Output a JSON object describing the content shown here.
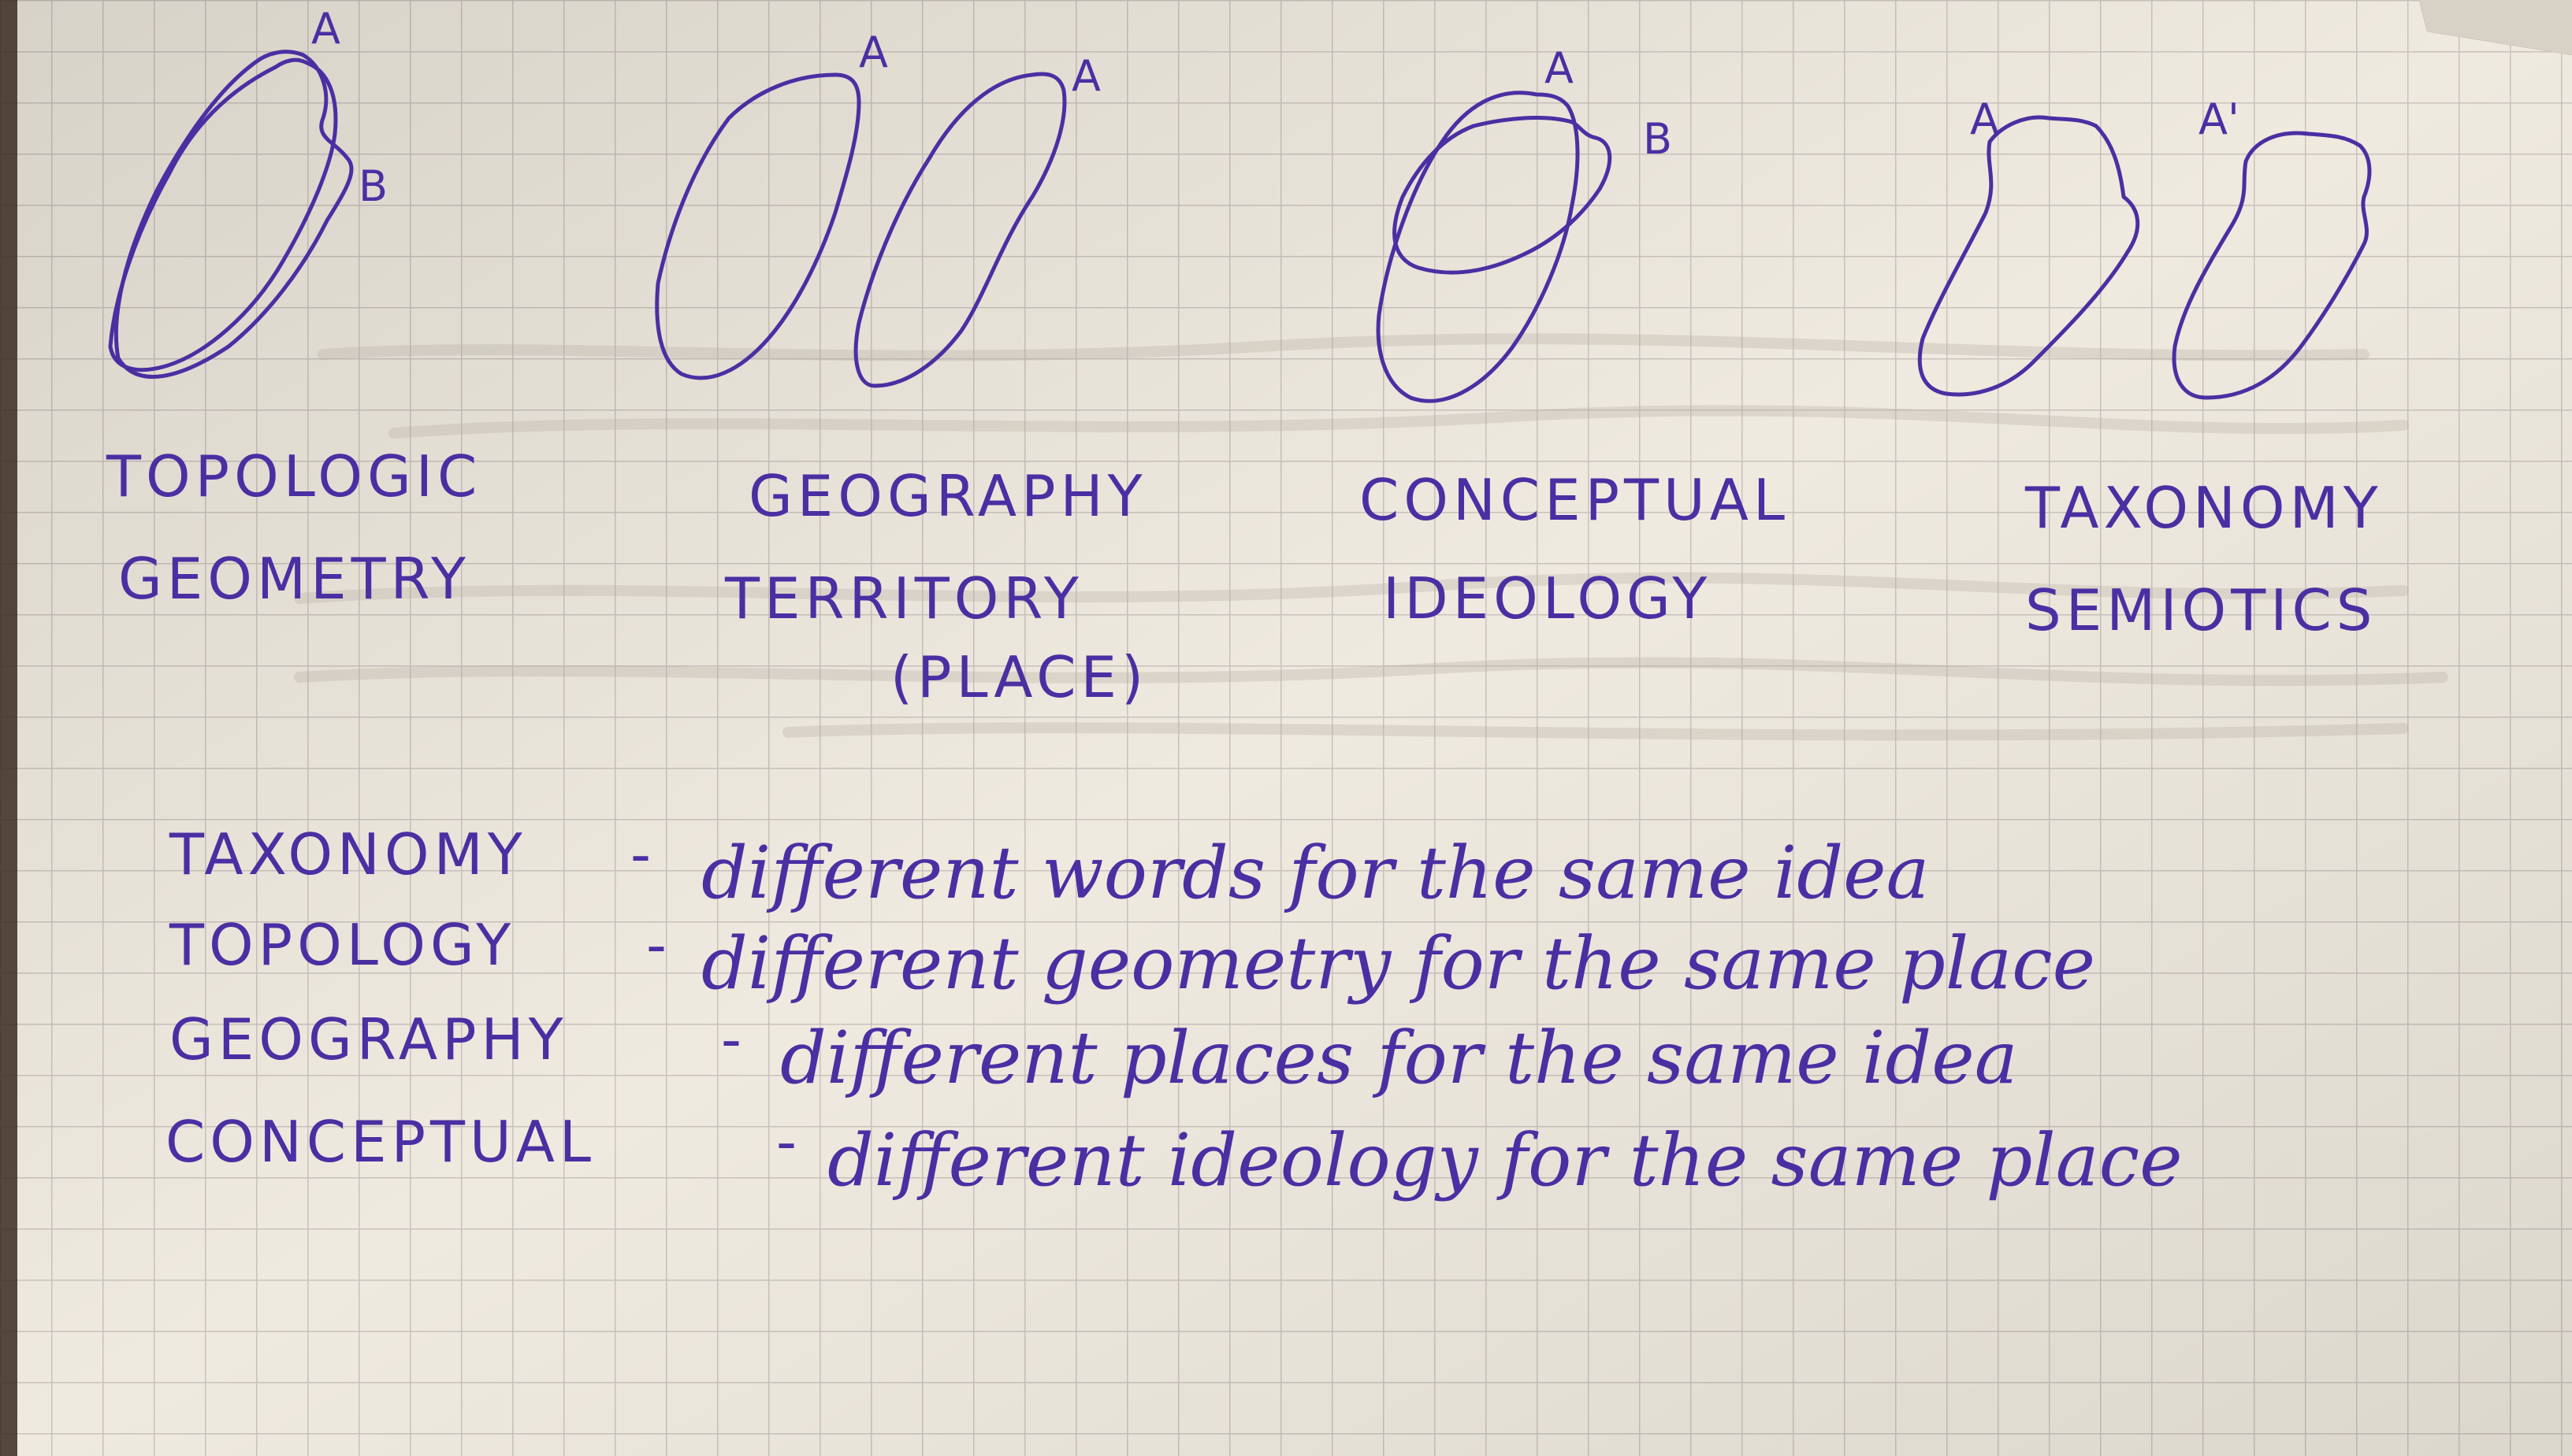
{
  "diagrams": [
    {
      "key": "topologic",
      "shape_labels": [
        "A",
        "B"
      ],
      "caption_lines": [
        "TOPOLOGIC",
        "GEOMETRY"
      ]
    },
    {
      "key": "geography",
      "shape_labels": [
        "A",
        "A"
      ],
      "caption_lines": [
        "GEOGRAPHY",
        "TERRITORY",
        "(PLACE)"
      ]
    },
    {
      "key": "conceptual",
      "shape_labels": [
        "A",
        "B"
      ],
      "caption_lines": [
        "CONCEPTUAL",
        "IDEOLOGY"
      ]
    },
    {
      "key": "taxonomy",
      "shape_labels": [
        "A",
        "A'"
      ],
      "caption_lines": [
        "TAXONOMY",
        "SEMIOTICS"
      ]
    }
  ],
  "definitions": [
    {
      "term": "TAXONOMY",
      "separator": "-",
      "text": "different words for the same idea"
    },
    {
      "term": "TOPOLOGY",
      "separator": "-",
      "text": "different geometry for the same place"
    },
    {
      "term": "GEOGRAPHY",
      "separator": "-",
      "text": "different places for the same idea"
    },
    {
      "term": "CONCEPTUAL",
      "separator": "-",
      "text": "different ideology for the same place"
    }
  ],
  "colors": {
    "paper": "#efeadf",
    "grid": "#c8c2bd",
    "ink": "#4a2fa3",
    "background": "#2a1c14"
  }
}
